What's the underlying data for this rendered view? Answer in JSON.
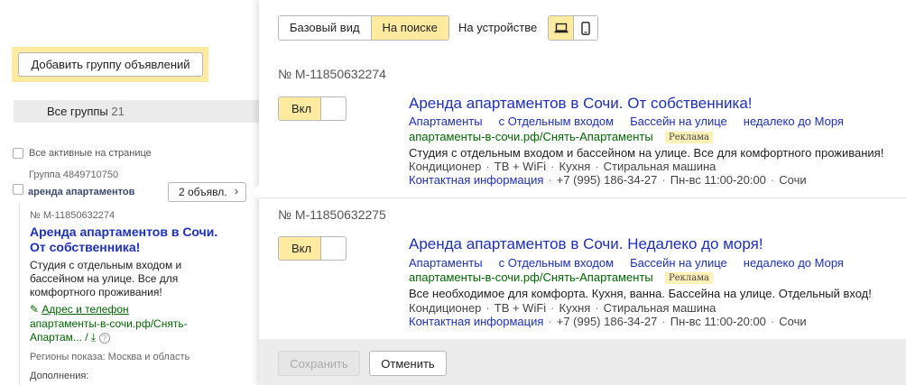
{
  "left": {
    "add_group_button": "Добавить группу объявлений",
    "groups_label": "Все группы",
    "groups_count": "21",
    "all_active_label": "Все активные на странице",
    "group_id": "Группа 4849710750",
    "group_name": "аренда апартаментов",
    "ads_button": "2 объявл.",
    "preview": {
      "id": "№ M-11850632274",
      "title": "Аренда апартаментов в Сочи. От собственника!",
      "text": "Студия с отдельным входом и бассейном на улице. Все для комфортного проживания!",
      "address_link": "Адрес и телефон",
      "url": "апартаменты-в-сочи.рф/Снять-Апартам... /",
      "regions": "Регионы показа: Москва и область",
      "extras": "Дополнения:"
    }
  },
  "right": {
    "view_tabs": [
      "Базовый вид",
      "На поиске"
    ],
    "device_label": "На устройстве",
    "device_icons": [
      "laptop-icon",
      "phone-icon"
    ],
    "toggle_label": "Вкл",
    "ad_badge": "Реклама",
    "ads": [
      {
        "number": "№ M-11850632274",
        "title": "Аренда апартаментов в Сочи. От собственника!",
        "sitelinks": [
          "Апартаменты",
          "с Отдельным входом",
          "Бассейн на улице",
          "недалеко до Моря"
        ],
        "url": "апартаменты-в-сочи.рф/Снять-Апартаменты",
        "text": "Студия с отдельным входом и бассейном на улице. Все для комфортного проживания!",
        "features": [
          "Кондиционер",
          "ТВ + WiFi",
          "Кухня",
          "Стиральная машина"
        ],
        "contact_link": "Контактная информация",
        "phone": "+7 (995) 186-34-27",
        "hours": "Пн-вс 11:00-20:00",
        "city": "Сочи"
      },
      {
        "number": "№ M-11850632275",
        "title": "Аренда апартаментов в Сочи. Недалеко до моря!",
        "sitelinks": [
          "Апартаменты",
          "с Отдельным входом",
          "Бассейн на улице",
          "недалеко до Моря"
        ],
        "url": "апартаменты-в-сочи.рф/Снять-Апартаменты",
        "text": "Все необходимое для комфорта. Кухня, ванна. Бассейна на улице. Отдельный вход!",
        "features": [
          "Кондиционер",
          "ТВ + WiFi",
          "Кухня",
          "Стиральная машина"
        ],
        "contact_link": "Контактная информация",
        "phone": "+7 (995) 186-34-27",
        "hours": "Пн-вс 11:00-20:00",
        "city": "Сочи"
      }
    ],
    "save_button": "Сохранить",
    "cancel_button": "Отменить"
  },
  "colors": {
    "accent_yellow": "#ffeba0",
    "link_blue": "#1d30b8",
    "url_green": "#006600"
  }
}
